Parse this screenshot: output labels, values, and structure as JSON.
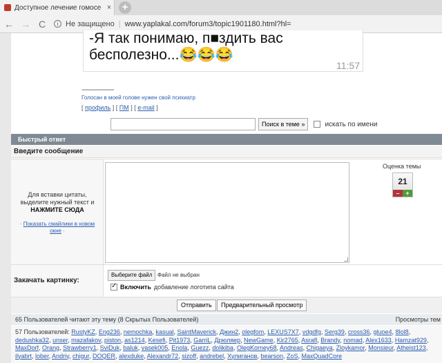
{
  "browser": {
    "tab_title": "Доступное лечение гомосексуа",
    "tab_close": "×",
    "new_tab": "+",
    "back": "←",
    "forward": "→",
    "reload": "C",
    "security_label": "Не защищено",
    "url": "www.yaplakal.com/forum3/topic1901180.html?hl="
  },
  "post": {
    "image_text_line1": "-Я так понимаю, п■здить вас",
    "image_text_line2": "бесполезно...😂😂😂",
    "image_time": "11:57",
    "sig_line": "--------------------",
    "sig_text": "Голосан в моей голове нужен свой психиатр",
    "profile": "профиль",
    "pm": "ПМ",
    "email": "e-mail"
  },
  "search": {
    "button": "Поиск в теме »",
    "by_name": "искать по имени"
  },
  "quick_reply": {
    "header": "Быстрый ответ",
    "subheader": "Введите сообщение",
    "hint_pre": "Для вставки цитаты, выделите нужный текст и",
    "hint_bold": "НАЖМИТЕ СЮДА",
    "smiles_link": "Показать смайлики в новом окне",
    "rating_label": "Оценка темы",
    "rating_value": "21",
    "rating_minus": "–",
    "rating_plus": "+"
  },
  "upload": {
    "label": "Закачать картинку:",
    "choose_file": "Выберите файл",
    "no_file": "Файл не выбран",
    "logo_bold": "Включить",
    "logo_rest": "добавление логотипа сайта"
  },
  "submit": {
    "send": "Отправить",
    "preview": "Предварительный просмотр"
  },
  "stats": {
    "reading": "65 Пользователей читают эту тему (8 Скрытых Пользователей)",
    "views": "Просмотры тем",
    "users_prefix": "57 Пользователей:",
    "users": [
      "RustyKZ",
      "Eng236",
      "nemochka",
      "kasual",
      "SaintMaverick",
      "Джин2",
      "olegfom",
      "LEXUS7X7",
      "vdgdfg",
      "Serg39",
      "cross36",
      "gluoe4",
      "8lol8",
      "dedushka32",
      "unser",
      "mazafakov",
      "piston",
      "as1214",
      "Kesefi",
      "Pit1973",
      "GarriL",
      "Дрюляер",
      "NewGame",
      "Kir2765",
      "Asrafl",
      "Brandy",
      "nomad",
      "Alex1633",
      "Hamzat929",
      "MaxDorf",
      "Orang",
      "Strawberry1",
      "SviDuk",
      "baluk",
      "vasek005",
      "Enola",
      "Guezz",
      "dolikiba",
      "OlegKorney68",
      "Andreas",
      "Chigaeya",
      "Zloykamor",
      "Monsieur",
      "Atheist123",
      "ilyabrt",
      "lober",
      "Andriy",
      "chigur",
      "DOQER",
      "alexduke",
      "Alexandr72",
      "sizoff",
      "andrebel",
      "Хулиганов",
      "bearson",
      "ZoS",
      "MaxQuadCore"
    ]
  }
}
